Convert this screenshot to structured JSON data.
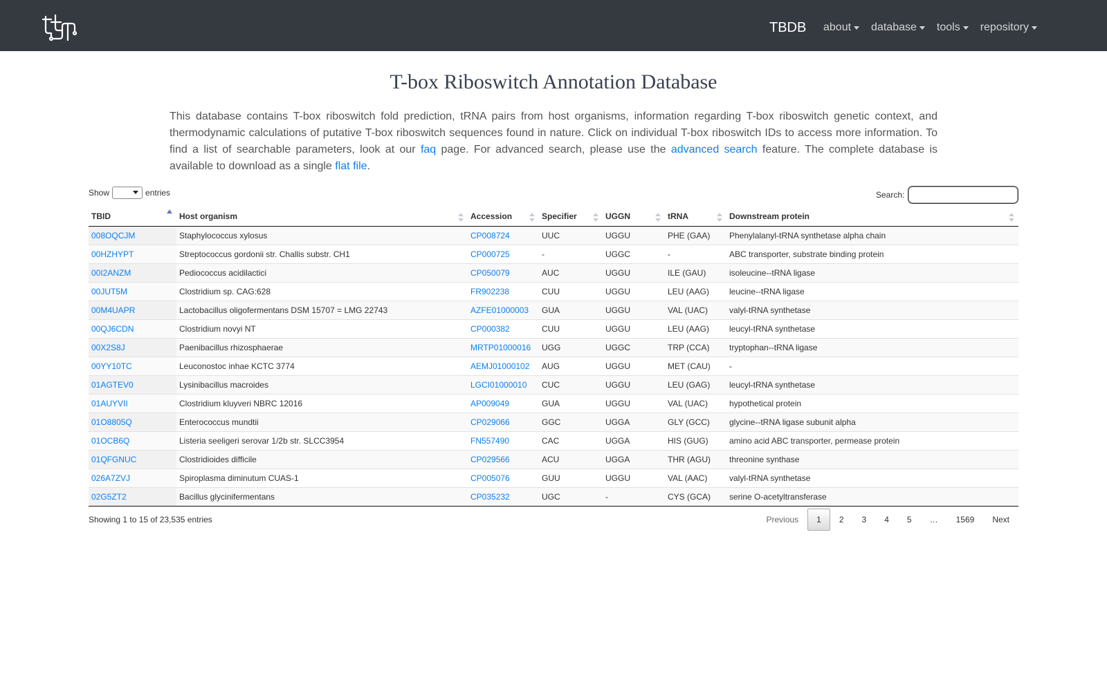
{
  "navbar": {
    "brand": "TBDB",
    "items": [
      {
        "label": "about"
      },
      {
        "label": "database"
      },
      {
        "label": "tools"
      },
      {
        "label": "repository"
      }
    ]
  },
  "page": {
    "title": "T-box Riboswitch Annotation Database",
    "intro": {
      "part1": "This database contains T-box riboswitch fold prediction, tRNA pairs from host organisms, information regarding T-box riboswitch genetic context, and thermodynamic calculations of putative T-box riboswitch sequences found in nature. Click on individual T-box riboswitch IDs to access more information. To find a list of searchable parameters, look at our ",
      "link_faq": "faq",
      "part2": " page. For advanced search, please use the ",
      "link_advanced": "advanced search",
      "part3": " feature. The complete database is available to download as a single ",
      "link_flat": "flat file",
      "part4": "."
    }
  },
  "controls": {
    "show_label": "Show",
    "entries_label": "entries",
    "search_label": "Search:",
    "search_value": ""
  },
  "table": {
    "columns": [
      "TBID",
      "Host organism",
      "Accession",
      "Specifier",
      "UGGN",
      "tRNA",
      "Downstream protein"
    ],
    "rows": [
      [
        "008OQCJM",
        "Staphylococcus xylosus",
        "CP008724",
        "UUC",
        "UGGU",
        "PHE (GAA)",
        "Phenylalanyl-tRNA synthetase alpha chain"
      ],
      [
        "00HZHYPT",
        "Streptococcus gordonii str. Challis substr. CH1",
        "CP000725",
        "-",
        "UGGC",
        "-",
        "ABC transporter, substrate binding protein"
      ],
      [
        "00I2ANZM",
        "Pediococcus acidilactici",
        "CP050079",
        "AUC",
        "UGGU",
        "ILE (GAU)",
        "isoleucine--tRNA ligase"
      ],
      [
        "00JUT5M",
        "Clostridium sp. CAG:628",
        "FR902238",
        "CUU",
        "UGGU",
        "LEU (AAG)",
        "leucine--tRNA ligase"
      ],
      [
        "00M4UAPR",
        "Lactobacillus oligofermentans DSM 15707 = LMG 22743",
        "AZFE01000003",
        "GUA",
        "UGGU",
        "VAL (UAC)",
        "valyl-tRNA synthetase"
      ],
      [
        "00QJ6CDN",
        "Clostridium novyi NT",
        "CP000382",
        "CUU",
        "UGGU",
        "LEU (AAG)",
        "leucyl-tRNA synthetase"
      ],
      [
        "00X2S8J",
        "Paenibacillus rhizosphaerae",
        "MRTP01000016",
        "UGG",
        "UGGC",
        "TRP (CCA)",
        "tryptophan--tRNA ligase"
      ],
      [
        "00YY10TC",
        "Leuconostoc inhae KCTC 3774",
        "AEMJ01000102",
        "AUG",
        "UGGU",
        "MET (CAU)",
        "-"
      ],
      [
        "01AGTEV0",
        "Lysinibacillus macroides",
        "LGCI01000010",
        "CUC",
        "UGGU",
        "LEU (GAG)",
        "leucyl-tRNA synthetase"
      ],
      [
        "01AUYVII",
        "Clostridium kluyveri NBRC 12016",
        "AP009049",
        "GUA",
        "UGGU",
        "VAL (UAC)",
        "hypothetical protein"
      ],
      [
        "01O8805Q",
        "Enterococcus mundtii",
        "CP029066",
        "GGC",
        "UGGA",
        "GLY (GCC)",
        "glycine--tRNA ligase subunit alpha"
      ],
      [
        "01OCB6Q",
        "Listeria seeligeri serovar 1/2b str. SLCC3954",
        "FN557490",
        "CAC",
        "UGGA",
        "HIS (GUG)",
        "amino acid ABC transporter, permease protein"
      ],
      [
        "01QFGNUC",
        "Clostridioides difficile",
        "CP029566",
        "ACU",
        "UGGA",
        "THR (AGU)",
        "threonine synthase"
      ],
      [
        "026A7ZVJ",
        "Spiroplasma diminutum CUAS-1",
        "CP005076",
        "GUU",
        "UGGU",
        "VAL (AAC)",
        "valyl-tRNA synthetase"
      ],
      [
        "02G5ZT2",
        "Bacillus glycinifermentans",
        "CP035232",
        "UGC",
        "-",
        "CYS (GCA)",
        "serine O-acetyltransferase"
      ]
    ]
  },
  "footer": {
    "info": "Showing 1 to 15 of 23,535 entries",
    "pagination": {
      "previous": "Previous",
      "pages": [
        "1",
        "2",
        "3",
        "4",
        "5"
      ],
      "ellipsis": "…",
      "last": "1569",
      "next": "Next"
    }
  }
}
